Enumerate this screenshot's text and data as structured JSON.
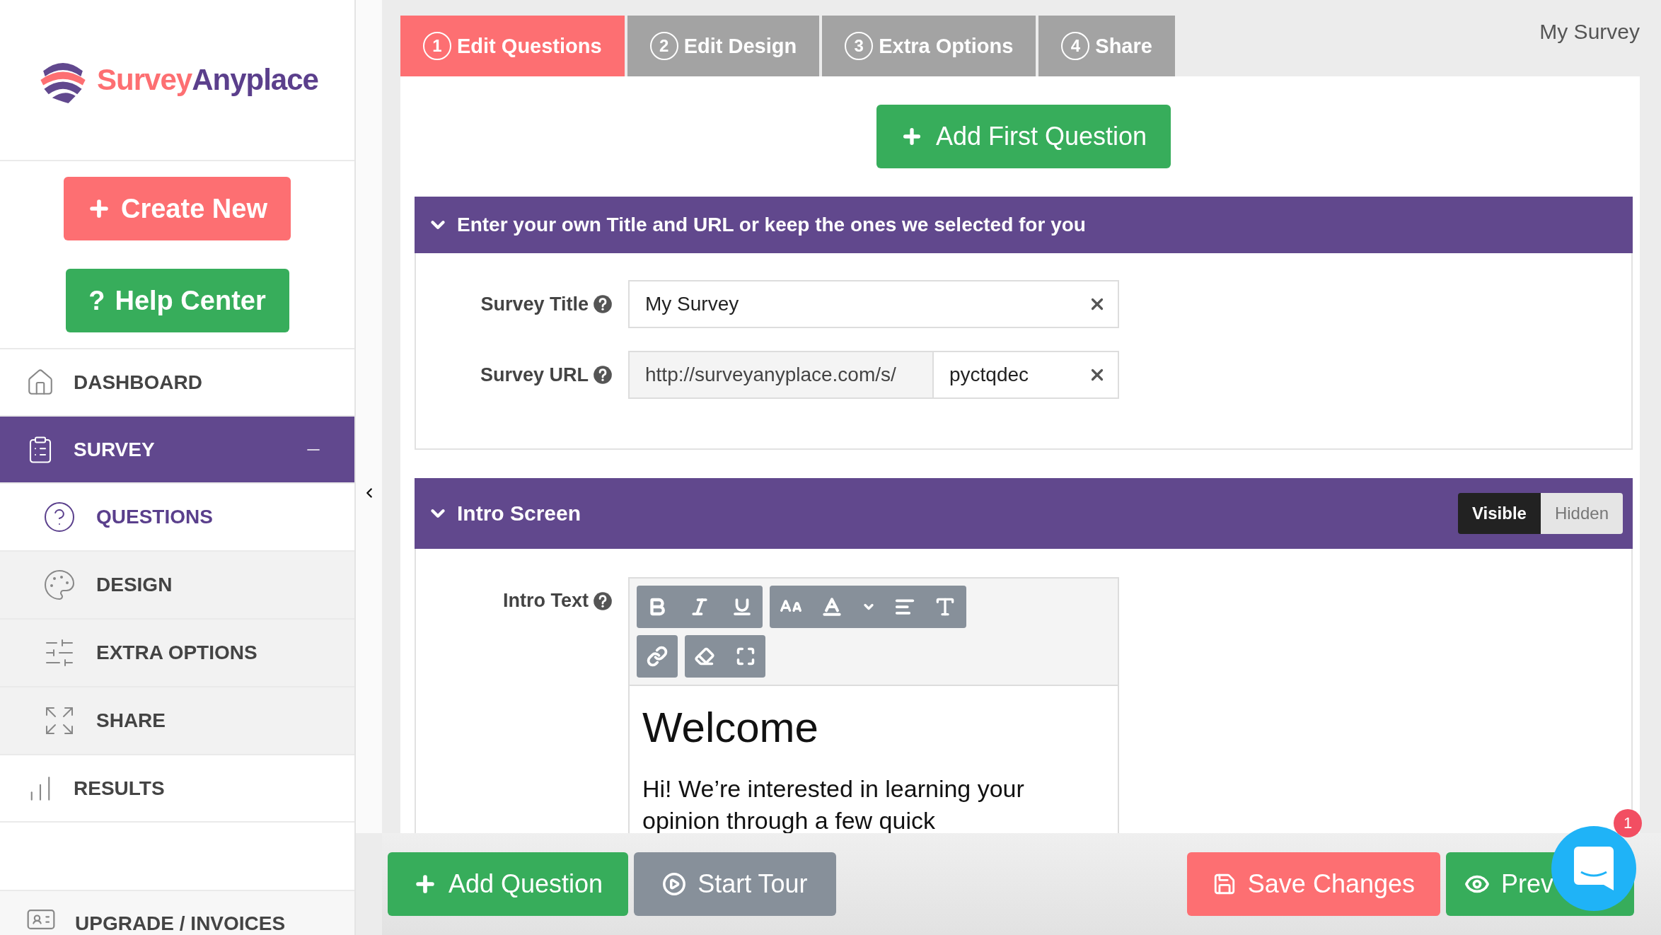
{
  "sidebar": {
    "logo": {
      "part1": "Survey",
      "part2": "Anyplace"
    },
    "create_button": "Create New",
    "help_button": {
      "mark": "?",
      "label": "Help Center"
    },
    "nav": [
      {
        "label": "DASHBOARD",
        "selected": false
      },
      {
        "label": "SURVEY",
        "selected": true,
        "expanded": true,
        "children": [
          {
            "label": "QUESTIONS",
            "selected": true
          },
          {
            "label": "DESIGN",
            "selected": false
          },
          {
            "label": "EXTRA OPTIONS",
            "selected": false
          },
          {
            "label": "SHARE",
            "selected": false
          }
        ]
      },
      {
        "label": "RESULTS",
        "selected": false
      }
    ],
    "footer_item": {
      "label": "UPGRADE / INVOICES"
    }
  },
  "tabs": [
    {
      "number": "1",
      "label": "Edit Questions",
      "selected": true
    },
    {
      "number": "2",
      "label": "Edit Design",
      "selected": false
    },
    {
      "number": "3",
      "label": "Extra Options",
      "selected": false
    },
    {
      "number": "4",
      "label": "Share",
      "selected": false
    }
  ],
  "document_title": "My Survey",
  "add_first_button": "Add First Question",
  "title_section": {
    "title": "Enter your own Title and URL or keep the ones we selected for you",
    "expanded": true,
    "survey_title": {
      "label": "Survey Title",
      "value": "My Survey"
    },
    "survey_url": {
      "label": "Survey URL",
      "prefix": "http://surveyanyplace.com/s/",
      "value": "pyctqdec"
    }
  },
  "intro_section": {
    "title": "Intro Screen",
    "expanded": true,
    "visibility": [
      {
        "label": "Visible",
        "selected": true
      },
      {
        "label": "Hidden",
        "selected": false
      }
    ],
    "intro_text_label": "Intro Text",
    "editor": {
      "heading": "Welcome",
      "paragraph": "Hi! We’re interested in learning your opinion through a few quick"
    }
  },
  "bottom_bar": {
    "add_question": "Add Question",
    "start_tour": "Start Tour",
    "save": "Save Changes",
    "preview": "Prev",
    "chat_badge": "1"
  }
}
